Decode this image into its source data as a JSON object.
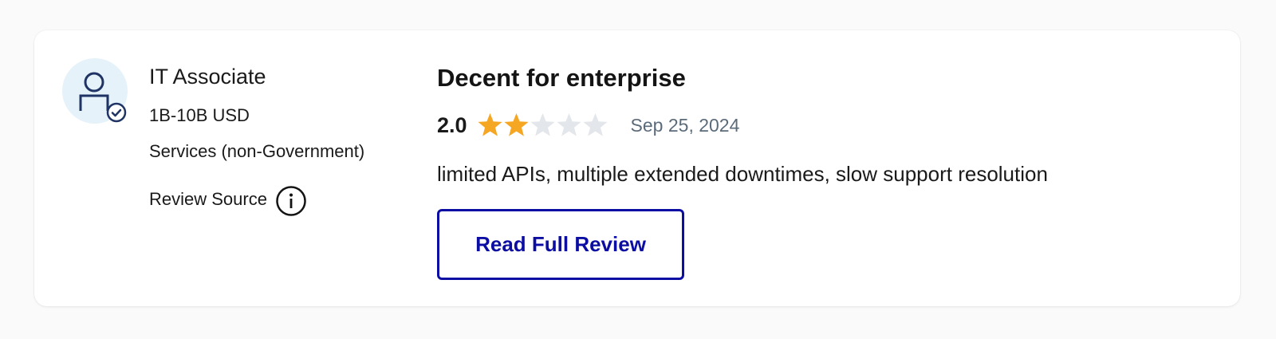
{
  "reviewer": {
    "avatar_icon": "verified-user-icon",
    "role": "IT Associate",
    "company_size": "1B-10B USD",
    "industry": "Services (non-Government)",
    "source_label": "Review Source",
    "source_info_icon": "info-icon"
  },
  "review": {
    "title": "Decent for enterprise",
    "rating": 2.0,
    "rating_text": "2.0",
    "max_rating": 5,
    "date": "Sep 25, 2024",
    "summary": "limited APIs, multiple extended downtimes, slow support resolution",
    "read_full_label": "Read Full Review"
  },
  "colors": {
    "star_filled": "#f5a623",
    "star_empty": "#e3e6ea",
    "button_accent": "#0c0ea3",
    "avatar_bg": "#e5f2fa",
    "avatar_icon": "#1f3464"
  }
}
